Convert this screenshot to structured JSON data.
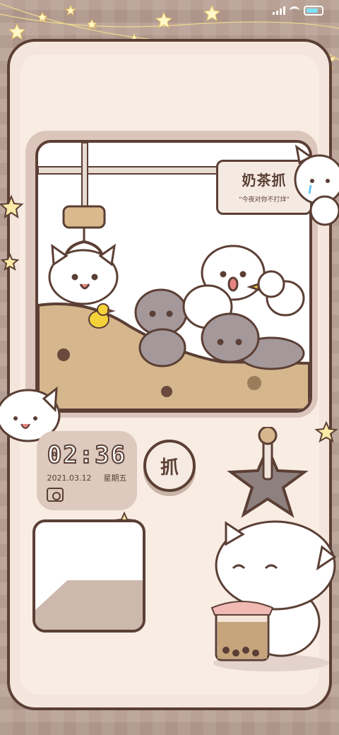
{
  "status_bar": {
    "signal_icon": "signal-bars-icon",
    "wifi_icon": "wifi-icon",
    "battery_icon": "battery-icon",
    "battery_color": "#7be2f7"
  },
  "claw_machine": {
    "sign_title": "奶茶抓",
    "sign_subtitle": "\"今夜对你不打烊\""
  },
  "clock_widget": {
    "time": "02:36",
    "date": "2021.03.12",
    "weekday": "星期五",
    "camera_icon": "camera-icon"
  },
  "grab_button": {
    "label": "抓"
  },
  "colors": {
    "outline": "#5b3f35",
    "frame_bg": "#f4e6dc",
    "card_bg": "#ddc9be",
    "star": "#fbe9a6"
  }
}
